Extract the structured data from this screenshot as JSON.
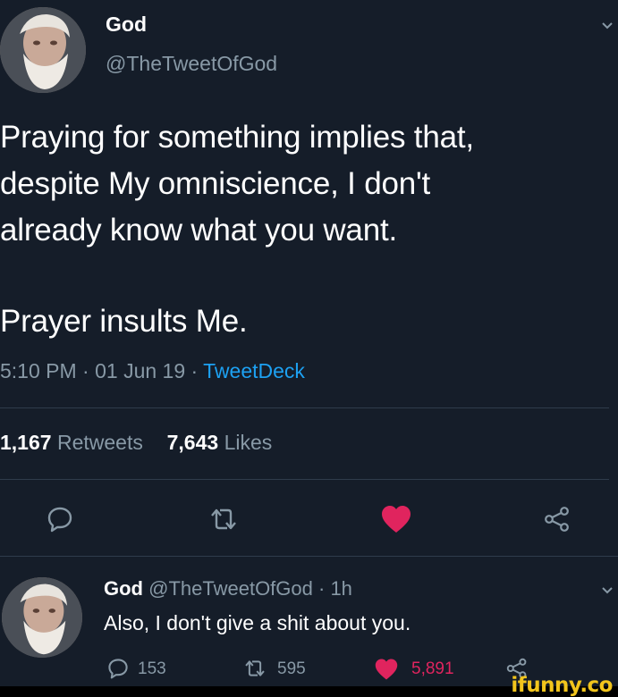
{
  "tweet": {
    "display_name": "God",
    "handle": "@TheTweetOfGod",
    "text_lines": [
      "Praying for something implies that,",
      "despite My omniscience, I don't",
      "already know what you want."
    ],
    "text_line2": "Prayer insults Me.",
    "time": "5:10 PM · 01 Jun 19 · ",
    "source": "TweetDeck",
    "retweet_count": "1,167",
    "retweet_label": "Retweets",
    "like_count": "7,643",
    "like_label": "Likes"
  },
  "reply": {
    "display_name": "God",
    "handle": "@TheTweetOfGod",
    "age": "· 1h",
    "text": "Also, I don't give a shit about you.",
    "reply_count": "153",
    "retweet_count": "595",
    "like_count": "5,891"
  },
  "watermark": "ifunny.co",
  "colors": {
    "background": "#151d29",
    "accent": "#1da1f2",
    "like": "#e0245e",
    "muted": "#8899a6"
  },
  "icons": [
    "reply-icon",
    "retweet-icon",
    "heart-icon",
    "share-icon",
    "chevron-down-icon"
  ]
}
